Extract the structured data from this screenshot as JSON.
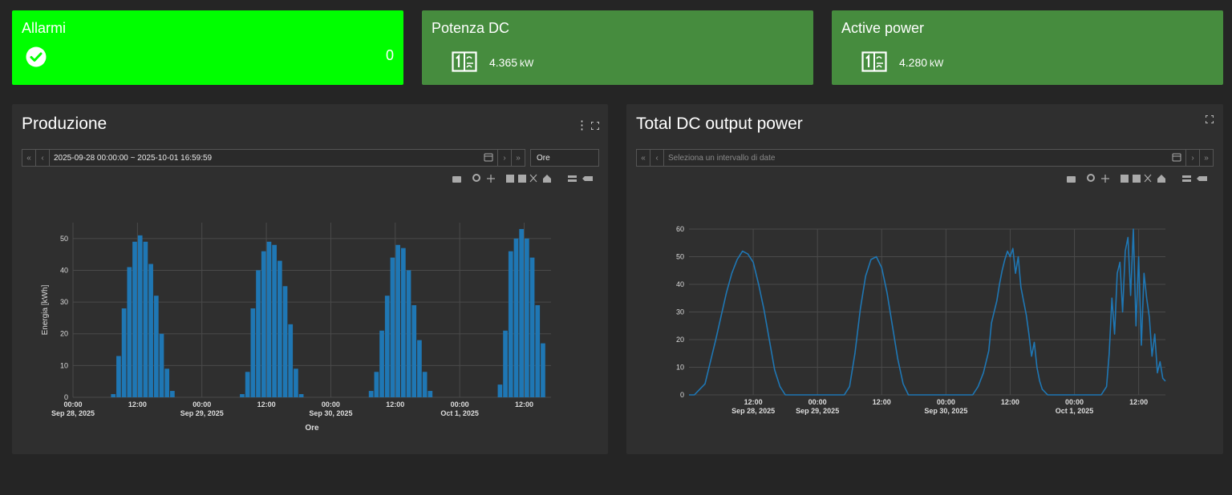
{
  "kpi": {
    "alarm": {
      "title": "Allarmi",
      "count": "0",
      "icon": "check-circle-icon"
    },
    "dc_power": {
      "title": "Potenza DC",
      "value": "4.365",
      "unit": "kW",
      "icon": "inverter-icon"
    },
    "active_power": {
      "title": "Active power",
      "value": "4.280",
      "unit": "kW",
      "icon": "inverter-icon"
    }
  },
  "colors": {
    "alarm_ok": "#00ff00",
    "kpi_bg": "#468c3e",
    "panel_bg": "#2f2f2f",
    "page_bg": "#252525",
    "series": "#1f77b4"
  },
  "panels": {
    "produzione": {
      "title": "Produzione",
      "date_range": "2025-09-28 00:00:00 ~ 2025-10-01 16:59:59",
      "granularity": "Ore"
    },
    "total_dc": {
      "title": "Total DC output power",
      "date_placeholder": "Seleziona un intervallo di date"
    }
  },
  "chart_data": [
    {
      "type": "bar",
      "xlabel": "Ore",
      "ylabel": "Energia [kWh]",
      "ylim": [
        0,
        55
      ],
      "yticks": [
        0,
        10,
        20,
        30,
        40,
        50
      ],
      "x_range_hours": [
        0,
        89
      ],
      "xticks": [
        {
          "h": 0,
          "l1": "00:00",
          "l2": "Sep 28, 2025"
        },
        {
          "h": 12,
          "l1": "12:00",
          "l2": ""
        },
        {
          "h": 24,
          "l1": "00:00",
          "l2": "Sep 29, 2025"
        },
        {
          "h": 36,
          "l1": "12:00",
          "l2": ""
        },
        {
          "h": 48,
          "l1": "00:00",
          "l2": "Sep 30, 2025"
        },
        {
          "h": 60,
          "l1": "12:00",
          "l2": ""
        },
        {
          "h": 72,
          "l1": "00:00",
          "l2": "Oct 1, 2025"
        },
        {
          "h": 84,
          "l1": "12:00",
          "l2": ""
        }
      ],
      "grid": true,
      "series": [
        {
          "hours": [
            7,
            8,
            9,
            10,
            11,
            12,
            13,
            14,
            15,
            16,
            17,
            18,
            31,
            32,
            33,
            34,
            35,
            36,
            37,
            38,
            39,
            40,
            41,
            42,
            55,
            56,
            57,
            58,
            59,
            60,
            61,
            62,
            63,
            64,
            65,
            66,
            79,
            80,
            81,
            82,
            83,
            84,
            85,
            86,
            87,
            88
          ],
          "values": [
            1,
            13,
            28,
            41,
            49,
            51,
            49,
            42,
            32,
            20,
            9,
            2,
            1,
            8,
            28,
            40,
            46,
            49,
            48,
            43,
            35,
            23,
            9,
            1,
            2,
            8,
            21,
            32,
            44,
            48,
            47,
            40,
            29,
            18,
            8,
            2,
            4,
            21,
            46,
            50,
            53,
            50,
            44,
            29,
            17
          ]
        }
      ]
    },
    {
      "type": "line",
      "ylim": [
        0,
        60
      ],
      "yticks": [
        0,
        10,
        20,
        30,
        40,
        50,
        60
      ],
      "x_range_hours": [
        0,
        89
      ],
      "xticks": [
        {
          "h": 12,
          "l1": "12:00",
          "l2": "Sep 28, 2025"
        },
        {
          "h": 24,
          "l1": "00:00",
          "l2": "Sep 29, 2025"
        },
        {
          "h": 36,
          "l1": "12:00",
          "l2": ""
        },
        {
          "h": 48,
          "l1": "00:00",
          "l2": "Sep 30, 2025"
        },
        {
          "h": 60,
          "l1": "12:00",
          "l2": ""
        },
        {
          "h": 72,
          "l1": "00:00",
          "l2": "Oct 1, 2025"
        },
        {
          "h": 84,
          "l1": "12:00",
          "l2": ""
        }
      ],
      "grid": true,
      "series": [
        {
          "x": [
            -4,
            1,
            3,
            5,
            7,
            8,
            9,
            10,
            11,
            12,
            13,
            14,
            15,
            16,
            17,
            18,
            19,
            20,
            21,
            29,
            30,
            31,
            32,
            33,
            34,
            35,
            36,
            37,
            38,
            39,
            40,
            41,
            42,
            43,
            44,
            45,
            53,
            54,
            55,
            56,
            56.5,
            57,
            57.5,
            58,
            58.5,
            59,
            59.5,
            60,
            60.5,
            61,
            61.5,
            62,
            62.5,
            63,
            63.5,
            64,
            64.5,
            65,
            65.5,
            66,
            67,
            68,
            69,
            77,
            78,
            78.5,
            79,
            79.5,
            80,
            80.5,
            81,
            81.5,
            82,
            82.5,
            83,
            83.5,
            84,
            84.5,
            85,
            85.5,
            86,
            86.5,
            87,
            87.5,
            88,
            88.5,
            89
          ],
          "y": [
            0,
            0,
            4,
            20,
            37,
            44,
            49,
            52,
            51,
            48,
            40,
            31,
            20,
            9,
            3,
            0,
            0,
            0,
            0,
            0,
            3,
            15,
            31,
            43,
            49,
            50,
            46,
            37,
            25,
            13,
            4,
            0,
            0,
            0,
            0,
            0,
            0,
            3,
            8,
            16,
            26,
            30,
            34,
            40,
            45,
            49,
            52,
            50,
            53,
            44,
            50,
            39,
            34,
            29,
            22,
            14,
            19,
            10,
            5,
            2,
            0,
            0,
            0,
            0,
            3,
            15,
            35,
            22,
            44,
            48,
            30,
            52,
            57,
            36,
            60,
            25,
            50,
            18,
            44,
            35,
            28,
            14,
            22,
            8,
            12,
            6,
            5
          ]
        }
      ]
    }
  ]
}
